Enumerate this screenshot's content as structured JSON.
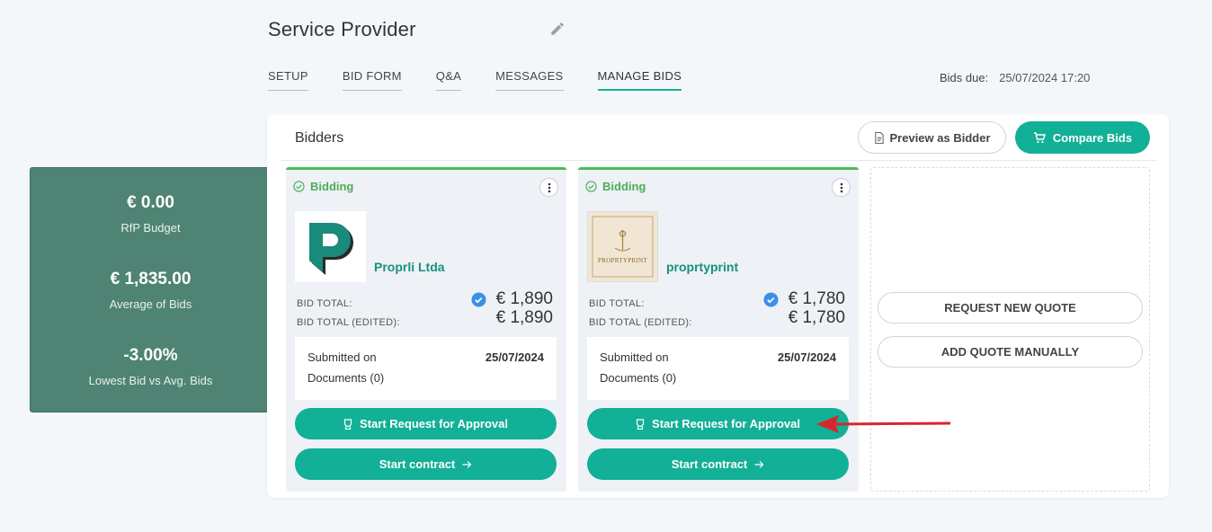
{
  "header": {
    "title": "Service Provider",
    "tabs": [
      {
        "label": "SETUP"
      },
      {
        "label": "BID FORM"
      },
      {
        "label": "Q&A"
      },
      {
        "label": "MESSAGES"
      },
      {
        "label": "MANAGE BIDS"
      }
    ],
    "active_tab": "MANAGE BIDS",
    "bids_due_label": "Bids due:",
    "bids_due_value": "25/07/2024 17:20"
  },
  "stats": [
    {
      "value": "€ 0.00",
      "label": "RfP Budget"
    },
    {
      "value": "€ 1,835.00",
      "label": "Average of Bids"
    },
    {
      "value": "-3.00%",
      "label": "Lowest Bid vs Avg. Bids"
    }
  ],
  "panel": {
    "title": "Bidders",
    "preview_label": "Preview as Bidder",
    "compare_label": "Compare Bids"
  },
  "bidders": [
    {
      "status": "Bidding",
      "name": "Proprli Ltda",
      "bid_total_label": "BID TOTAL:",
      "bid_total": "€ 1,890",
      "bid_total_edited_label": "BID TOTAL (EDITED):",
      "bid_total_edited": "€ 1,890",
      "submitted_label": "Submitted on",
      "submitted_date": "25/07/2024",
      "documents": "Documents (0)",
      "approval_label": "Start Request for Approval",
      "contract_label": "Start contract"
    },
    {
      "status": "Bidding",
      "name": "proprtyprint",
      "logo_text": "PROPRTYPRINT",
      "bid_total_label": "BID TOTAL:",
      "bid_total": "€ 1,780",
      "bid_total_edited_label": "BID TOTAL (EDITED):",
      "bid_total_edited": "€ 1,780",
      "submitted_label": "Submitted on",
      "submitted_date": "25/07/2024",
      "documents": "Documents (0)",
      "approval_label": "Start Request for Approval",
      "contract_label": "Start contract"
    }
  ],
  "actions": {
    "request_quote": "REQUEST NEW QUOTE",
    "add_quote": "ADD QUOTE MANUALLY"
  },
  "colors": {
    "accent": "#12b096",
    "stats_bg": "#4f8474",
    "bidding_green": "#4cbb5a",
    "annotation_arrow": "#d9262a"
  }
}
